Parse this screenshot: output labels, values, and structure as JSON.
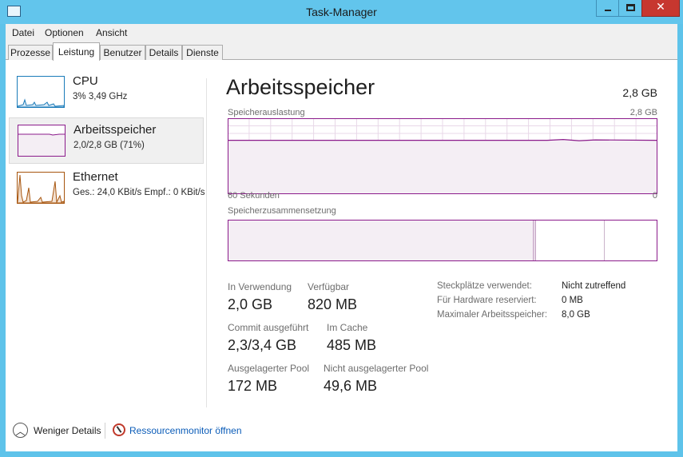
{
  "window": {
    "title": "Task-Manager",
    "close_glyph": "✕"
  },
  "menu": [
    "Datei",
    "Optionen",
    "Ansicht"
  ],
  "tabs": [
    "Prozesse",
    "Leistung",
    "Benutzer",
    "Details",
    "Dienste"
  ],
  "active_tab": "Leistung",
  "sidebar": [
    {
      "title": "CPU",
      "subtitle": "3% 3,49 GHz",
      "icon": "cpu-graph-thumbnail",
      "color": "#1a7bb9"
    },
    {
      "title": "Arbeitsspeicher",
      "subtitle": "2,0/2,8 GB (71%)",
      "icon": "memory-graph-thumbnail",
      "color": "#8b1b8b"
    },
    {
      "title": "Ethernet",
      "subtitle": "Ges.: 24,0 KBit/s  Empf.: 0 KBit/s",
      "icon": "ethernet-graph-thumbnail",
      "color": "#a7550e"
    }
  ],
  "main": {
    "title": "Arbeitsspeicher",
    "total": "2,8 GB",
    "usage_graph": {
      "label": "Speicherauslastung",
      "max_label": "2,8 GB",
      "time_label": "60 Sekunden",
      "min_label": "0",
      "level": 0.71
    },
    "composition": {
      "label": "Speicherzusammensetzung",
      "in_use_fraction": 0.71
    },
    "stats": [
      {
        "label": "In Verwendung",
        "value": "2,0 GB"
      },
      {
        "label": "Verfügbar",
        "value": "820 MB"
      },
      {
        "label": "Commit ausgeführt",
        "value": "2,3/3,4 GB"
      },
      {
        "label": "Im Cache",
        "value": "485 MB"
      },
      {
        "label": "Ausgelagerter Pool",
        "value": "172 MB"
      },
      {
        "label": "Nicht ausgelagerter Pool",
        "value": "49,6 MB"
      }
    ],
    "details": [
      {
        "label": "Steckplätze verwendet:",
        "value": "Nicht zutreffend"
      },
      {
        "label": "Für Hardware reserviert:",
        "value": "0 MB"
      },
      {
        "label": "Maximaler Arbeitsspeicher:",
        "value": "8,0 GB"
      }
    ]
  },
  "footer": {
    "fewer_details": "Weniger Details",
    "resmon_link": "Ressourcenmonitor öffnen",
    "chevron_glyph": "︿"
  },
  "colors": {
    "accent": "#8b1b8b",
    "titlebar": "#62c5ec",
    "link": "#0b5cb8"
  }
}
